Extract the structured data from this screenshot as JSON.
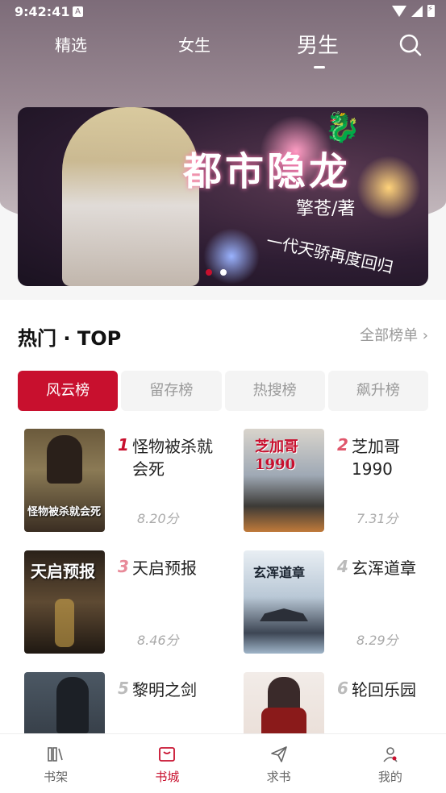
{
  "status_bar": {
    "time": "9:42:41",
    "notification_badge": "A"
  },
  "top_tabs": [
    {
      "label": "精选"
    },
    {
      "label": "女生"
    },
    {
      "label": "男生",
      "active": true
    }
  ],
  "banner": {
    "title": "都市隐龙",
    "author": "擎苍/著",
    "tagline": "一代天骄再度回归",
    "dots_count": 2,
    "active_dot": 0
  },
  "section": {
    "title": "热门 · TOP",
    "more_label": "全部榜单 ›"
  },
  "rank_tabs": [
    {
      "label": "风云榜",
      "active": true
    },
    {
      "label": "留存榜"
    },
    {
      "label": "热搜榜"
    },
    {
      "label": "飙升榜"
    }
  ],
  "books": [
    {
      "rank": "1",
      "title": "怪物被杀就会死",
      "score": "8.20分",
      "cover_text": "怪物被杀就会死",
      "rank_color": "#c8102e"
    },
    {
      "rank": "2",
      "title": "芝加哥1990",
      "score": "7.31分",
      "cover_text": "芝加哥1990",
      "rank_color": "#e0566b"
    },
    {
      "rank": "3",
      "title": "天启预报",
      "score": "8.46分",
      "cover_text": "天启预报",
      "rank_color": "#e88a99"
    },
    {
      "rank": "4",
      "title": "玄浑道章",
      "score": "8.29分",
      "cover_text": "玄浑道章",
      "rank_color": "#bbbbbb"
    },
    {
      "rank": "5",
      "title": "黎明之剑",
      "score": "",
      "cover_text": "",
      "rank_color": "#bbbbbb"
    },
    {
      "rank": "6",
      "title": "轮回乐园",
      "score": "",
      "cover_text": "",
      "rank_color": "#bbbbbb"
    }
  ],
  "bottom_nav": [
    {
      "label": "书架",
      "icon": "bookshelf-icon"
    },
    {
      "label": "书城",
      "icon": "bookstore-icon",
      "active": true
    },
    {
      "label": "求书",
      "icon": "paper-plane-icon"
    },
    {
      "label": "我的",
      "icon": "profile-icon"
    }
  ],
  "colors": {
    "accent": "#c8102e"
  }
}
